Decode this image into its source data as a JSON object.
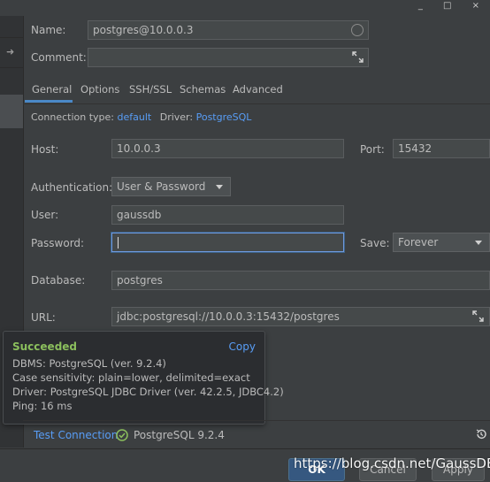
{
  "window": {
    "controls": "_ □ ×"
  },
  "form": {
    "name_label": "Name:",
    "name_value": "postgres@10.0.0.3",
    "comment_label": "Comment:",
    "comment_value": ""
  },
  "tabs": [
    {
      "label": "General",
      "active": true
    },
    {
      "label": "Options"
    },
    {
      "label": "SSH/SSL"
    },
    {
      "label": "Schemas"
    },
    {
      "label": "Advanced"
    }
  ],
  "info": {
    "connection_type_label": "Connection type:",
    "connection_type_value": "default",
    "driver_label": "Driver:",
    "driver_value": "PostgreSQL"
  },
  "fields": {
    "host_label": "Host:",
    "host_value": "10.0.0.3",
    "port_label": "Port:",
    "port_value": "15432",
    "auth_label": "Authentication:",
    "auth_value": "User & Password",
    "user_label": "User:",
    "user_value": "gaussdb",
    "password_label": "Password:",
    "password_value": "",
    "save_label": "Save:",
    "save_value": "Forever",
    "database_label": "Database:",
    "database_value": "postgres",
    "url_label": "URL:",
    "url_value": "jdbc:postgresql://10.0.0.3:15432/postgres"
  },
  "popup": {
    "title": "Succeeded",
    "copy": "Copy",
    "lines": [
      "DBMS: PostgreSQL (ver. 9.2.4)",
      "Case sensitivity: plain=lower, delimited=exact",
      "Driver: PostgreSQL JDBC Driver (ver. 42.2.5, JDBC4.2)",
      "Ping: 16 ms"
    ]
  },
  "test": {
    "link": "Test Connection",
    "result": "PostgreSQL 9.2.4"
  },
  "buttons": {
    "ok": "OK",
    "cancel": "Cancel",
    "apply": "Apply"
  },
  "watermark": "https://blog.csdn.net/GaussDB",
  "colors": {
    "accent": "#589df6",
    "success": "#8bbf5d",
    "focus": "#6f9ae0"
  }
}
